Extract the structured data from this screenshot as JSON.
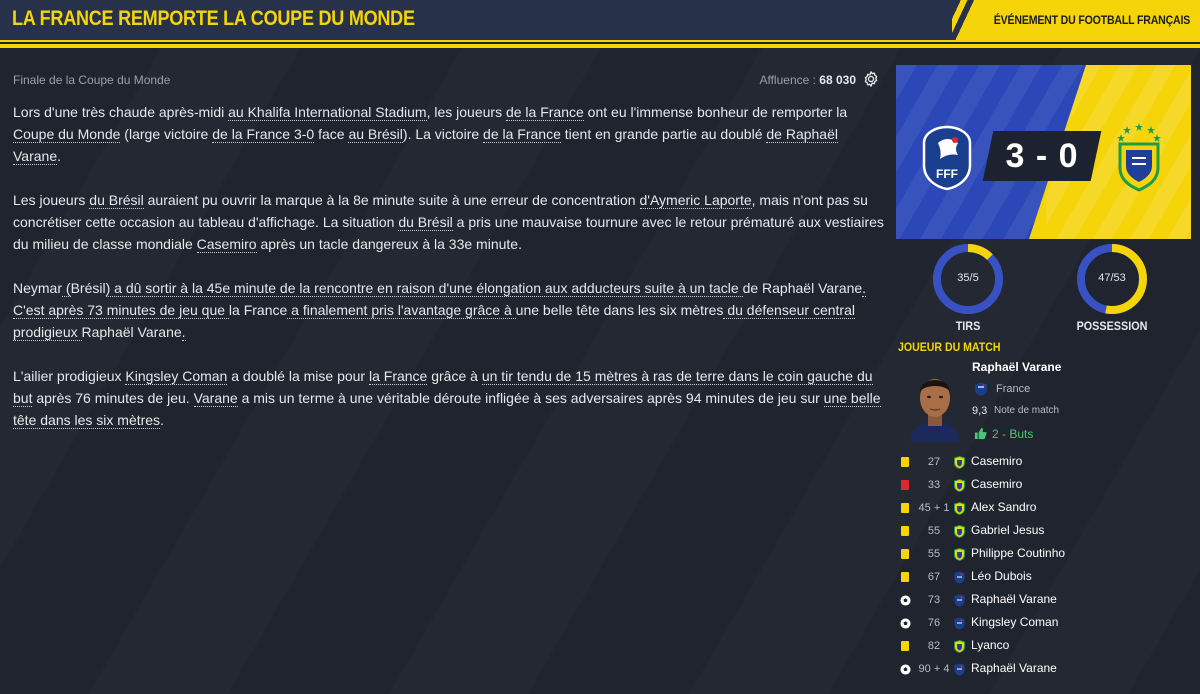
{
  "header": {
    "title": "LA FRANCE REMPORTE LA COUPE DU MONDE",
    "tag": "ÉVÉNEMENT DU FOOTBALL FRANÇAIS"
  },
  "meta": {
    "subtitle": "Finale de la Coupe du Monde",
    "attendance_label": "Affluence :",
    "attendance_value": "68 030"
  },
  "article": {
    "p1": [
      "Lors d'une très chaude après-midi ",
      "au Khalifa International Stadium",
      ", les joueurs ",
      "de la France",
      " ont eu l'immense bonheur de remporter la ",
      "Coupe du Monde",
      " (large victoire ",
      "de la France 3-0",
      " face ",
      "au Brésil",
      "). La victoire ",
      "de la France",
      " tient en grande partie au doublé ",
      "de Raphaël Varane",
      "."
    ],
    "p2": [
      "Les joueurs ",
      "du Brésil",
      " auraient pu ouvrir la marque à la 8e minute suite à une erreur de concentration ",
      "d'Aymeric Laporte",
      ", mais n'ont pas su concrétiser cette occasion au tableau d'affichage. La situation ",
      "du Brésil",
      " a pris une mauvaise tournure avec le retour prématuré aux vestiaires du milieu de classe mondiale ",
      "Casemiro",
      " après un tacle dangereux à la 33e minute."
    ],
    "p3": [
      "Neymar",
      " (",
      "Brésil",
      ") a dû sortir à la 45e minute de la rencontre en raison d'une élongation aux adducteurs suite à un tacle ",
      "de Raphaël Varane",
      ". C'est après 73 minutes de jeu que ",
      "la France",
      " a finalement pris l'avantage grâce à ",
      "une belle tête dans les six mètres",
      " du défenseur central prodigieux ",
      "Raphaël Varane",
      "."
    ],
    "p4": [
      "L'ailier prodigieux ",
      "Kingsley Coman",
      " a doublé la mise pour ",
      "la France",
      " grâce à ",
      "un tir tendu de 15 mètres à ras de terre dans le coin gauche du but",
      " après 76 minutes de jeu. ",
      "Varane",
      " a mis un terme à une véritable déroute infligée à ses adversaires après 94 minutes de jeu sur ",
      "une belle tête dans les six mètres",
      "."
    ]
  },
  "scoreboard": {
    "score": "3 - 0",
    "home_crest_text": "FFF"
  },
  "stats": {
    "shots": {
      "label": "35/5",
      "title": "TIRS",
      "home": 35,
      "away": 5
    },
    "possession": {
      "label": "47/53",
      "title": "POSSESSION",
      "home": 47,
      "away": 53
    }
  },
  "potm": {
    "title": "JOUEUR DU MATCH",
    "name": "Raphaël Varane",
    "nation": "France",
    "rating": "9,3",
    "rating_label": "Note de match",
    "goals": "2 - Buts"
  },
  "events": [
    {
      "type": "yellow",
      "minute": "27",
      "team": "bra",
      "player": "Casemiro"
    },
    {
      "type": "red",
      "minute": "33",
      "team": "bra",
      "player": "Casemiro"
    },
    {
      "type": "yellow",
      "minute": "45 + 1",
      "team": "bra",
      "player": "Alex Sandro"
    },
    {
      "type": "yellow",
      "minute": "55",
      "team": "bra",
      "player": "Gabriel Jesus"
    },
    {
      "type": "yellow",
      "minute": "55",
      "team": "bra",
      "player": "Philippe Coutinho"
    },
    {
      "type": "yellow",
      "minute": "67",
      "team": "fra",
      "player": "Léo Dubois"
    },
    {
      "type": "goal",
      "minute": "73",
      "team": "fra",
      "player": "Raphaël Varane"
    },
    {
      "type": "goal",
      "minute": "76",
      "team": "fra",
      "player": "Kingsley Coman"
    },
    {
      "type": "yellow",
      "minute": "82",
      "team": "bra",
      "player": "Lyanco"
    },
    {
      "type": "goal",
      "minute": "90 + 4",
      "team": "fra",
      "player": "Raphaël Varane"
    }
  ],
  "colors": {
    "accent": "#f5d40a",
    "france_blue": "#2c48b8",
    "ring_blue": "#3852c4",
    "ring_yellow": "#f5d40a",
    "goal_green": "#48c978",
    "red_card": "#e0262f"
  }
}
